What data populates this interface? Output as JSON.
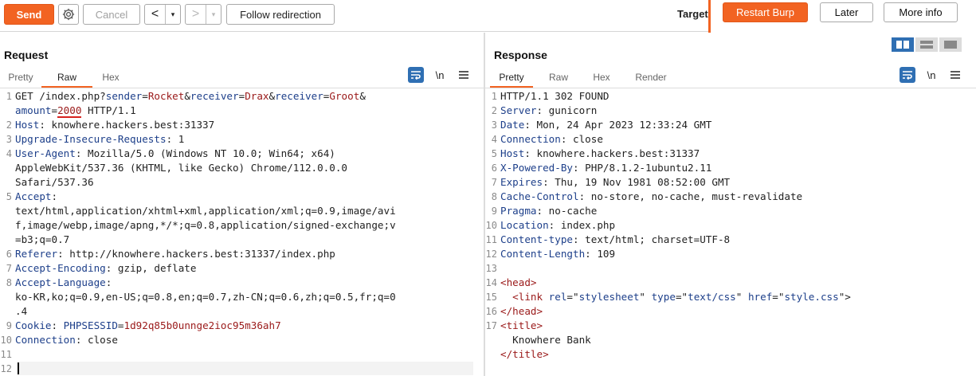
{
  "toolbar": {
    "send_label": "Send",
    "cancel_label": "Cancel",
    "back_glyph": "<",
    "forward_glyph": ">",
    "dropdown_glyph": "▾",
    "follow_label": "Follow redirection",
    "target_label": "Target",
    "accent_color": "#f26322"
  },
  "notification": {
    "restart_label": "Restart Burp",
    "later_label": "Later",
    "more_label": "More info"
  },
  "request": {
    "title": "Request",
    "tabs": [
      "Pretty",
      "Raw",
      "Hex"
    ],
    "active_tab": "Raw",
    "icons": [
      "wrap-icon",
      "newline-icon",
      "menu-icon"
    ],
    "newline_glyph": "\\n",
    "lines": [
      {
        "n": "1",
        "parts": [
          [
            "GET /index.php?",
            ""
          ],
          [
            "sender",
            "hk"
          ],
          [
            "=",
            ""
          ],
          [
            "Rocket",
            "pv"
          ],
          [
            "&",
            ""
          ],
          [
            "receiver",
            "hk"
          ],
          [
            "=",
            ""
          ],
          [
            "Drax",
            "pv"
          ],
          [
            "&",
            ""
          ],
          [
            "receiver",
            "hk"
          ],
          [
            "=",
            ""
          ],
          [
            "Groot",
            "pv"
          ],
          [
            "&",
            ""
          ],
          [
            "\n",
            ""
          ],
          [
            "amount",
            "hk"
          ],
          [
            "=",
            ""
          ],
          [
            "2000",
            "pv ul"
          ],
          [
            " HTTP/1.1",
            ""
          ]
        ]
      },
      {
        "n": "2",
        "parts": [
          [
            "Host",
            "hk"
          ],
          [
            ": knowhere.hackers.best:31337",
            ""
          ]
        ]
      },
      {
        "n": "3",
        "parts": [
          [
            "Upgrade-Insecure-Requests",
            "hk"
          ],
          [
            ": 1",
            ""
          ]
        ]
      },
      {
        "n": "4",
        "parts": [
          [
            "User-Agent",
            "hk"
          ],
          [
            ": Mozilla/5.0 (Windows NT 10.0; Win64; x64)\nAppleWebKit/537.36 (KHTML, like Gecko) Chrome/112.0.0.0\nSafari/537.36",
            ""
          ]
        ]
      },
      {
        "n": "5",
        "parts": [
          [
            "Accept",
            "hk"
          ],
          [
            ":\ntext/html,application/xhtml+xml,application/xml;q=0.9,image/avi\nf,image/webp,image/apng,*/*;q=0.8,application/signed-exchange;v\n=b3;q=0.7",
            ""
          ]
        ]
      },
      {
        "n": "6",
        "parts": [
          [
            "Referer",
            "hk"
          ],
          [
            ": http://knowhere.hackers.best:31337/index.php",
            ""
          ]
        ]
      },
      {
        "n": "7",
        "parts": [
          [
            "Accept-Encoding",
            "hk"
          ],
          [
            ": gzip, deflate",
            ""
          ]
        ]
      },
      {
        "n": "8",
        "parts": [
          [
            "Accept-Language",
            "hk"
          ],
          [
            ":\nko-KR,ko;q=0.9,en-US;q=0.8,en;q=0.7,zh-CN;q=0.6,zh;q=0.5,fr;q=0\n.4",
            ""
          ]
        ]
      },
      {
        "n": "9",
        "parts": [
          [
            "Cookie",
            "hk"
          ],
          [
            ": ",
            ""
          ],
          [
            "PHPSESSID",
            "hk"
          ],
          [
            "=",
            ""
          ],
          [
            "1d92q85b0unnge2ioc95m36ah7",
            "pv"
          ]
        ]
      },
      {
        "n": "10",
        "parts": [
          [
            "Connection",
            "hk"
          ],
          [
            ": close",
            ""
          ]
        ]
      },
      {
        "n": "11",
        "parts": [
          [
            "",
            ""
          ]
        ]
      },
      {
        "n": "12",
        "parts": [
          [
            "",
            ""
          ]
        ]
      }
    ]
  },
  "response": {
    "title": "Response",
    "tabs": [
      "Pretty",
      "Raw",
      "Hex",
      "Render"
    ],
    "active_tab": "Pretty",
    "icons": [
      "wrap-icon",
      "newline-icon",
      "menu-icon"
    ],
    "newline_glyph": "\\n",
    "layout_views": [
      "split-horizontal",
      "split-vertical",
      "single"
    ],
    "lines": [
      {
        "n": "1",
        "parts": [
          [
            "HTTP/1.1 302 FOUND",
            ""
          ]
        ]
      },
      {
        "n": "2",
        "parts": [
          [
            "Server",
            "hk"
          ],
          [
            ": gunicorn",
            ""
          ]
        ]
      },
      {
        "n": "3",
        "parts": [
          [
            "Date",
            "hk"
          ],
          [
            ": Mon, 24 Apr 2023 12:33:24 GMT",
            ""
          ]
        ]
      },
      {
        "n": "4",
        "parts": [
          [
            "Connection",
            "hk"
          ],
          [
            ": close",
            ""
          ]
        ]
      },
      {
        "n": "5",
        "parts": [
          [
            "Host",
            "hk"
          ],
          [
            ": knowhere.hackers.best:31337",
            ""
          ]
        ]
      },
      {
        "n": "6",
        "parts": [
          [
            "X-Powered-By",
            "hk"
          ],
          [
            ": PHP/8.1.2-1ubuntu2.11",
            ""
          ]
        ]
      },
      {
        "n": "7",
        "parts": [
          [
            "Expires",
            "hk"
          ],
          [
            ": Thu, 19 Nov 1981 08:52:00 GMT",
            ""
          ]
        ]
      },
      {
        "n": "8",
        "parts": [
          [
            "Cache-Control",
            "hk"
          ],
          [
            ": no-store, no-cache, must-revalidate",
            ""
          ]
        ]
      },
      {
        "n": "9",
        "parts": [
          [
            "Pragma",
            "hk"
          ],
          [
            ": no-cache",
            ""
          ]
        ]
      },
      {
        "n": "10",
        "parts": [
          [
            "Location",
            "hk"
          ],
          [
            ": index.php",
            ""
          ]
        ]
      },
      {
        "n": "11",
        "parts": [
          [
            "Content-type",
            "hk"
          ],
          [
            ": text/html; charset=UTF-8",
            ""
          ]
        ]
      },
      {
        "n": "12",
        "parts": [
          [
            "Content-Length",
            "hk"
          ],
          [
            ": 109",
            ""
          ]
        ]
      },
      {
        "n": "13",
        "parts": [
          [
            "",
            ""
          ]
        ]
      },
      {
        "n": "14",
        "parts": [
          [
            "<head>",
            "tag"
          ]
        ]
      },
      {
        "n": "15",
        "parts": [
          [
            "  ",
            ""
          ],
          [
            "<link ",
            "tag"
          ],
          [
            "rel",
            "attr"
          ],
          [
            "=\"",
            ""
          ],
          [
            "stylesheet",
            "str"
          ],
          [
            "\" ",
            ""
          ],
          [
            "type",
            "attr"
          ],
          [
            "=\"",
            ""
          ],
          [
            "text/css",
            "str"
          ],
          [
            "\" ",
            ""
          ],
          [
            "href",
            "attr"
          ],
          [
            "=\"",
            ""
          ],
          [
            "style.css",
            "str"
          ],
          [
            "\">",
            ""
          ],
          [
            "\n",
            ""
          ]
        ]
      },
      {
        "n": "16",
        "parts": [
          [
            "</head>",
            "tag"
          ]
        ]
      },
      {
        "n": "17",
        "parts": [
          [
            "<title>",
            "tag"
          ],
          [
            "\n  Knowhere Bank\n",
            ""
          ],
          [
            "</title>",
            "tag"
          ]
        ]
      }
    ]
  }
}
